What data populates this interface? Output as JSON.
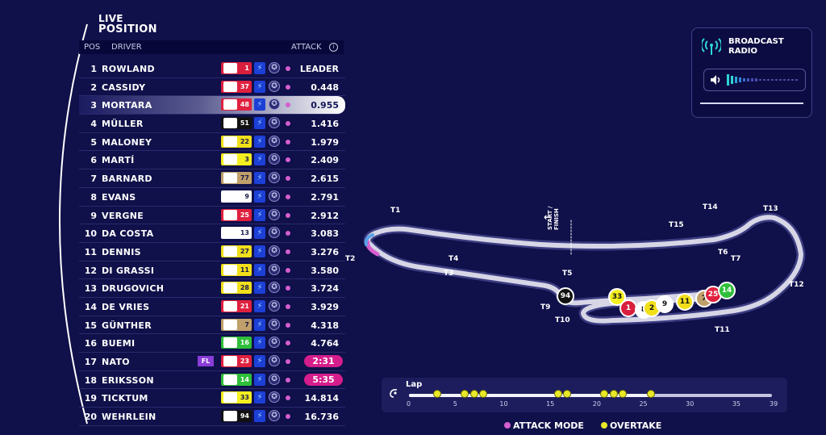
{
  "title_line1": "LIVE",
  "title_line2": "POSITION",
  "headers": {
    "pos": "POS",
    "driver": "DRIVER",
    "attack": "ATTACK",
    "info_icon": "info-icon"
  },
  "colors": {
    "background": "#10104a",
    "attack_mode": "#d55fcf",
    "overtake": "#e8e82a",
    "pill": "#d51d8c",
    "fastest_lap": "#8a3dd8"
  },
  "drivers": [
    {
      "pos": "1",
      "name": "ROWLAND",
      "num": "1",
      "gap": "LEADER",
      "team_color": "#d81f3d",
      "num_color": "#ffffff"
    },
    {
      "pos": "2",
      "name": "CASSIDY",
      "num": "37",
      "gap": "0.448",
      "team_color": "#e0203f",
      "num_color": "#ffffff"
    },
    {
      "pos": "3",
      "name": "MORTARA",
      "num": "48",
      "gap": "0.955",
      "team_color": "#e0203f",
      "num_color": "#ffffff"
    },
    {
      "pos": "4",
      "name": "MÜLLER",
      "num": "51",
      "gap": "1.416",
      "team_color": "#111111",
      "num_color": "#ffffff"
    },
    {
      "pos": "5",
      "name": "MALONEY",
      "num": "22",
      "gap": "1.979",
      "team_color": "#f1df1a",
      "num_color": "#1a1a4a"
    },
    {
      "pos": "6",
      "name": "MARTÍ",
      "num": "3",
      "gap": "2.409",
      "team_color": "#f5ef20",
      "num_color": "#1a1a4a"
    },
    {
      "pos": "7",
      "name": "BARNARD",
      "num": "77",
      "gap": "2.615",
      "team_color": "#c0a06a",
      "num_color": "#1a1a4a"
    },
    {
      "pos": "8",
      "name": "EVANS",
      "num": "9",
      "gap": "2.791",
      "team_color": "#ffffff",
      "num_color": "#1a1a4a"
    },
    {
      "pos": "9",
      "name": "VERGNE",
      "num": "25",
      "gap": "2.912",
      "team_color": "#e0203f",
      "num_color": "#ffffff"
    },
    {
      "pos": "10",
      "name": "DA COSTA",
      "num": "13",
      "gap": "3.083",
      "team_color": "#ffffff",
      "num_color": "#1a1a4a"
    },
    {
      "pos": "11",
      "name": "DENNIS",
      "num": "27",
      "gap": "3.276",
      "team_color": "#f1df1a",
      "num_color": "#1a1a4a"
    },
    {
      "pos": "12",
      "name": "DI GRASSI",
      "num": "11",
      "gap": "3.580",
      "team_color": "#f1df1a",
      "num_color": "#1a1a4a"
    },
    {
      "pos": "13",
      "name": "DRUGOVICH",
      "num": "28",
      "gap": "3.724",
      "team_color": "#f1df1a",
      "num_color": "#1a1a4a"
    },
    {
      "pos": "14",
      "name": "DE VRIES",
      "num": "21",
      "gap": "3.929",
      "team_color": "#e0203f",
      "num_color": "#ffffff"
    },
    {
      "pos": "15",
      "name": "GÜNTHER",
      "num": "7",
      "gap": "4.318",
      "team_color": "#c0a06a",
      "num_color": "#1a1a4a"
    },
    {
      "pos": "16",
      "name": "BUEMI",
      "num": "16",
      "gap": "4.764",
      "team_color": "#2fbf3a",
      "num_color": "#ffffff"
    },
    {
      "pos": "17",
      "name": "NATO",
      "num": "23",
      "gap": "2:31",
      "team_color": "#e0203f",
      "num_color": "#ffffff",
      "fl": "FL",
      "pill": true
    },
    {
      "pos": "18",
      "name": "ERIKSSON",
      "num": "14",
      "gap": "5:35",
      "team_color": "#2fbf3a",
      "num_color": "#ffffff",
      "pill": true
    },
    {
      "pos": "19",
      "name": "TICKTUM",
      "num": "33",
      "gap": "14.814",
      "team_color": "#f5ef20",
      "num_color": "#1a1a4a"
    },
    {
      "pos": "20",
      "name": "WEHRLEIN",
      "num": "94",
      "gap": "16.736",
      "team_color": "#111111",
      "num_color": "#ffffff"
    }
  ],
  "radio": {
    "title_line1": "BROADCAST",
    "title_line2": "RADIO",
    "antenna_icon": "antenna-icon",
    "speaker_icon": "speaker-icon"
  },
  "track": {
    "turns": [
      "T1",
      "T2",
      "T3",
      "T4",
      "T5",
      "T6",
      "T7",
      "T9",
      "T10",
      "T11",
      "T12",
      "T13",
      "T14",
      "T15"
    ],
    "start_finish_line1": "START /",
    "start_finish_line2": "FINISH",
    "markers": [
      "94",
      "33",
      "1",
      "8",
      "2",
      "9",
      "11",
      "7",
      "25",
      "14"
    ]
  },
  "lap": {
    "label": "Lap",
    "icon": "lap-icon",
    "ticks": [
      "0",
      "5",
      "10",
      "15",
      "20",
      "25",
      "30",
      "35",
      "39"
    ],
    "total": 39,
    "current": 26,
    "overtake_laps": [
      3,
      6,
      7,
      8,
      16,
      17,
      21,
      22,
      23,
      26
    ]
  },
  "legend": {
    "attack": "ATTACK MODE",
    "overtake": "OVERTAKE"
  }
}
